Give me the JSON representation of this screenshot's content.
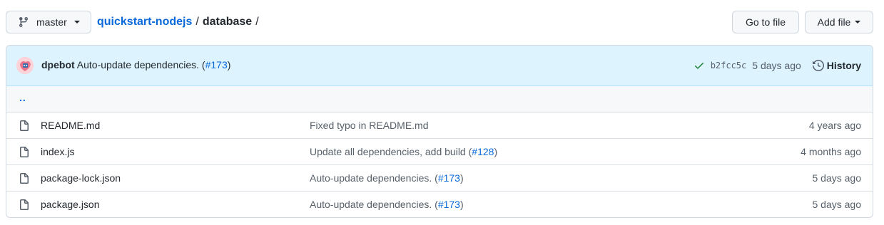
{
  "branch": {
    "name": "master"
  },
  "breadcrumb": {
    "repo": "quickstart-nodejs",
    "sep1": "/",
    "dir": "database",
    "sep2": "/"
  },
  "actions": {
    "go_to_file": "Go to file",
    "add_file": "Add file"
  },
  "latest_commit": {
    "author": "dpebot",
    "message_prefix": "Auto-update dependencies. (",
    "pr": "#173",
    "message_suffix": ")",
    "sha": "b2fcc5c",
    "age": "5 days ago",
    "history_label": "History"
  },
  "parent_dir": "..",
  "files": [
    {
      "name": "README.md",
      "msg_prefix": "Fixed typo in README.md",
      "pr": "",
      "msg_suffix": "",
      "age": "4 years ago"
    },
    {
      "name": "index.js",
      "msg_prefix": "Update all dependencies, add build (",
      "pr": "#128",
      "msg_suffix": ")",
      "age": "4 months ago"
    },
    {
      "name": "package-lock.json",
      "msg_prefix": "Auto-update dependencies. (",
      "pr": "#173",
      "msg_suffix": ")",
      "age": "5 days ago"
    },
    {
      "name": "package.json",
      "msg_prefix": "Auto-update dependencies. (",
      "pr": "#173",
      "msg_suffix": ")",
      "age": "5 days ago"
    }
  ],
  "colors": {
    "link": "#0969da",
    "success": "#1a7f37",
    "commit_bg": "#ddf4ff"
  }
}
